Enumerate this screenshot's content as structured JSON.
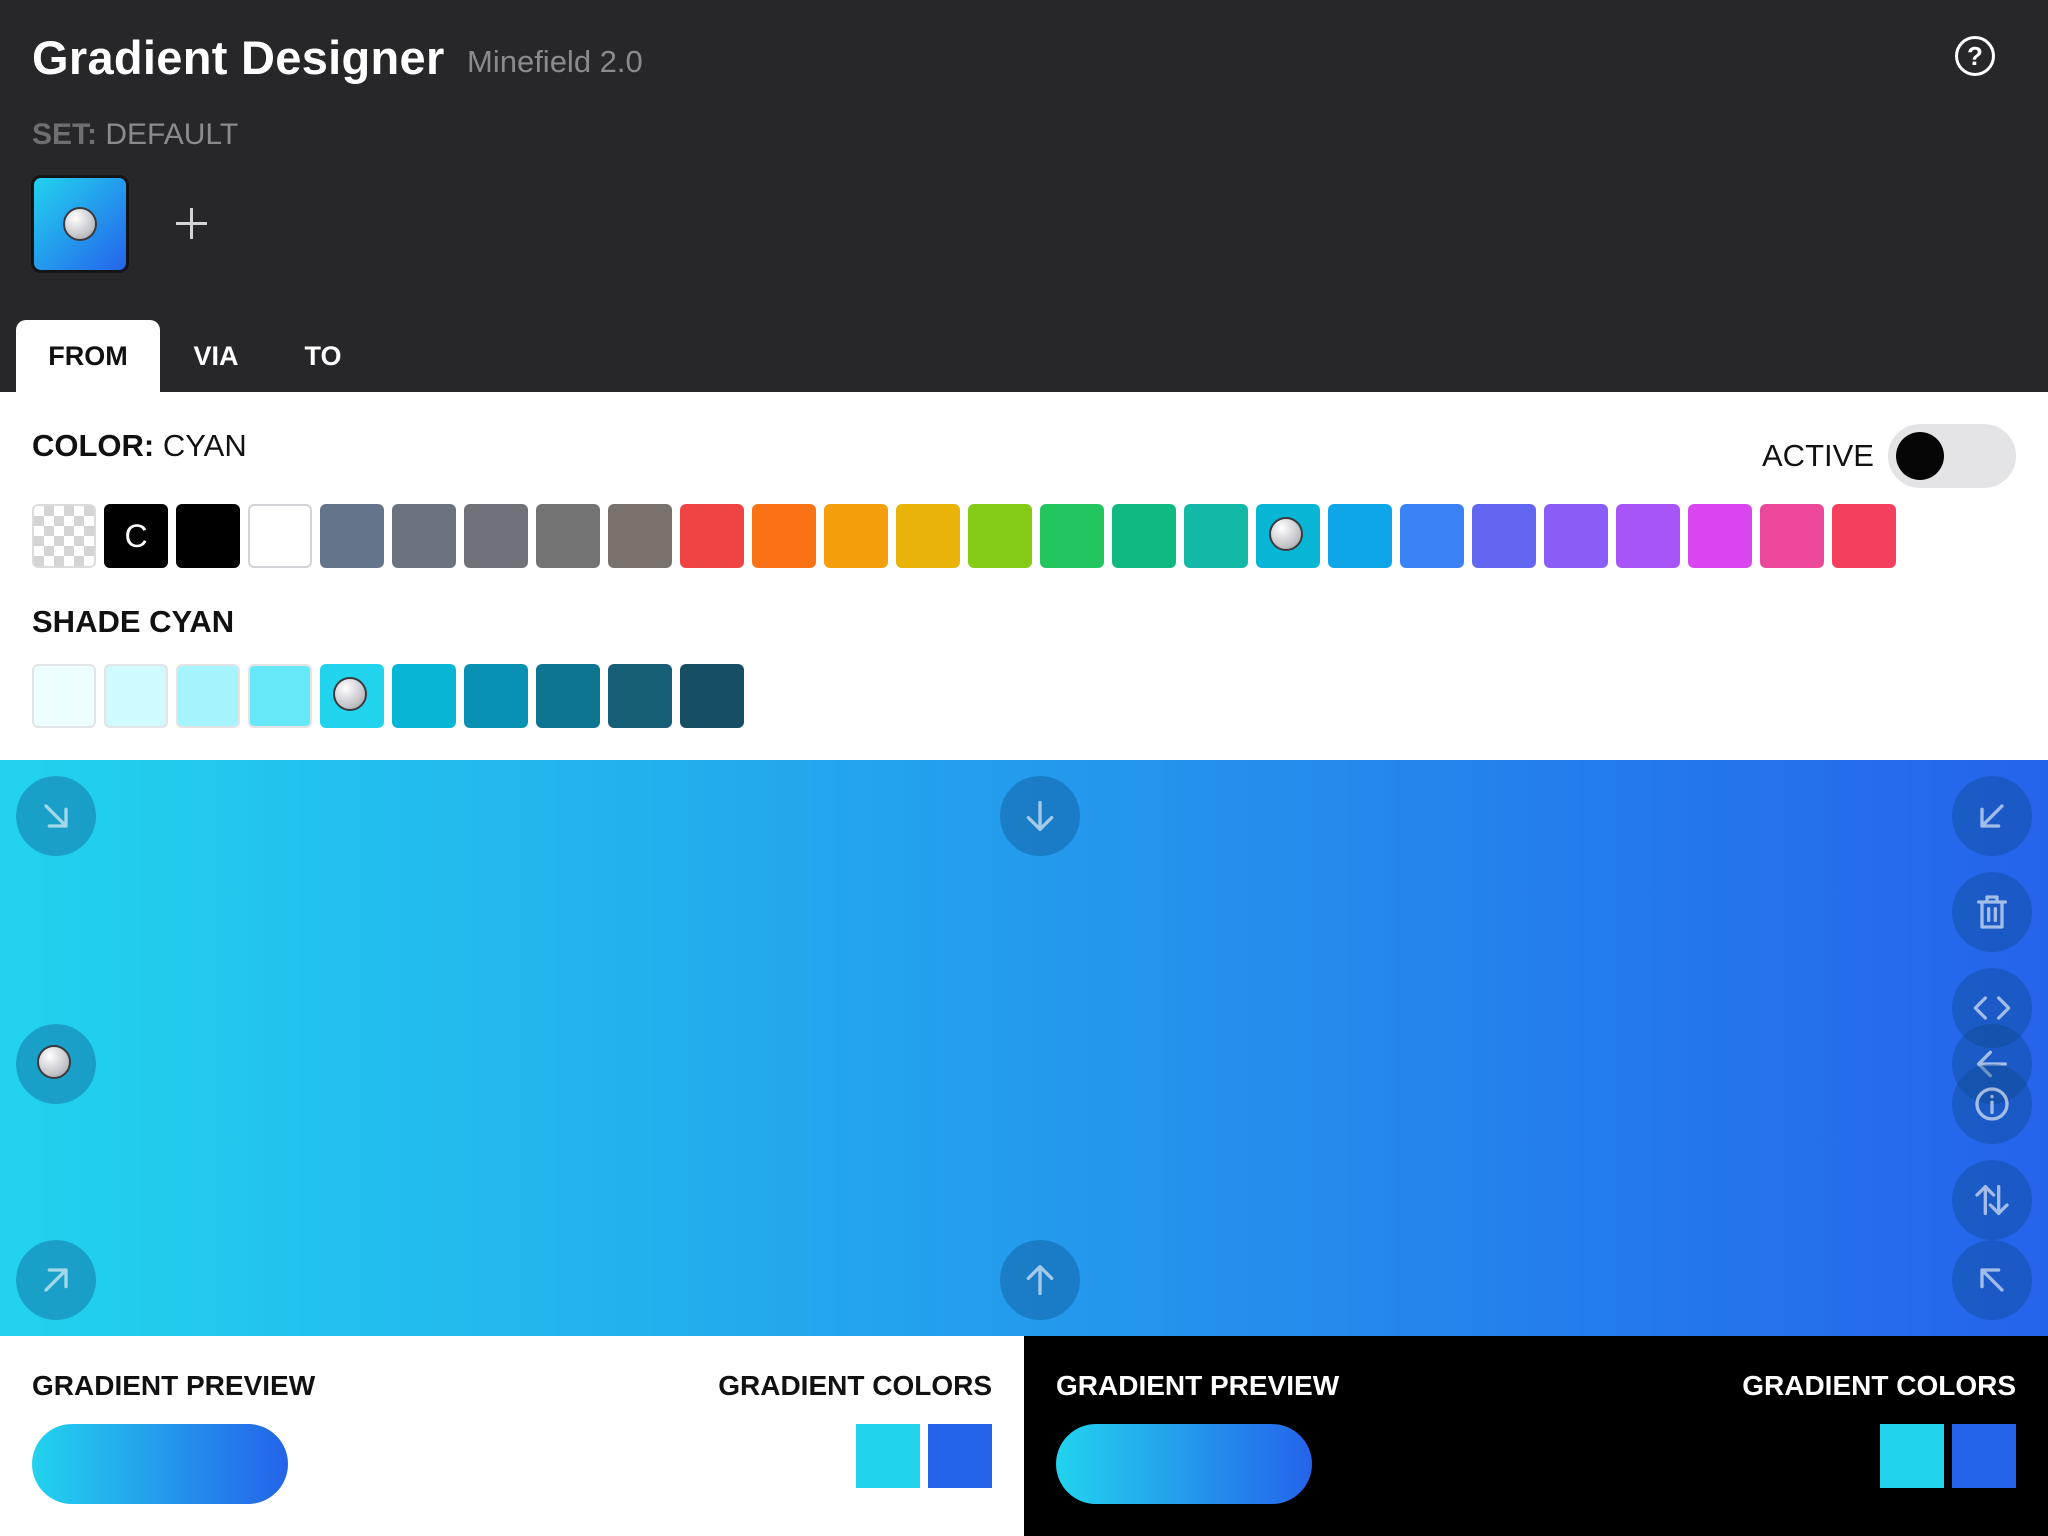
{
  "header": {
    "title": "Gradient Designer",
    "subtitle": "Minefield 2.0",
    "set_label": "SET:",
    "set_value": "DEFAULT",
    "help_glyph": "?",
    "help_icon": "question-circle-icon",
    "add_icon": "plus-icon"
  },
  "tabs": [
    {
      "label": "FROM",
      "active": true
    },
    {
      "label": "VIA",
      "active": false
    },
    {
      "label": "TO",
      "active": false
    }
  ],
  "color_panel": {
    "label": "COLOR:",
    "value": "CYAN",
    "active_label": "ACTIVE",
    "active_on": false,
    "current_swatch_letter": "C",
    "swatches": [
      {
        "name": "transparent",
        "hex": "transparent"
      },
      {
        "name": "current",
        "hex": "#000000"
      },
      {
        "name": "black",
        "hex": "#000000"
      },
      {
        "name": "white",
        "hex": "#ffffff"
      },
      {
        "name": "slate",
        "hex": "#64748b"
      },
      {
        "name": "gray",
        "hex": "#6b7280"
      },
      {
        "name": "zinc",
        "hex": "#71717a"
      },
      {
        "name": "neutral",
        "hex": "#737373"
      },
      {
        "name": "stone",
        "hex": "#78716c"
      },
      {
        "name": "red",
        "hex": "#ef4444"
      },
      {
        "name": "orange",
        "hex": "#f97316"
      },
      {
        "name": "amber",
        "hex": "#f59e0b"
      },
      {
        "name": "yellow",
        "hex": "#eab308"
      },
      {
        "name": "lime",
        "hex": "#84cc16"
      },
      {
        "name": "green",
        "hex": "#22c55e"
      },
      {
        "name": "emerald",
        "hex": "#10b981"
      },
      {
        "name": "teal",
        "hex": "#14b8a6"
      },
      {
        "name": "cyan",
        "hex": "#06b6d4",
        "selected": true
      },
      {
        "name": "sky",
        "hex": "#0ea5e9"
      },
      {
        "name": "blue",
        "hex": "#3b82f6"
      },
      {
        "name": "indigo",
        "hex": "#6366f1"
      },
      {
        "name": "violet",
        "hex": "#8b5cf6"
      },
      {
        "name": "purple",
        "hex": "#a855f7"
      },
      {
        "name": "fuchsia",
        "hex": "#d946ef"
      },
      {
        "name": "pink",
        "hex": "#ec4899"
      },
      {
        "name": "rose",
        "hex": "#f43f5e"
      }
    ]
  },
  "shade_panel": {
    "label": "SHADE CYAN",
    "shades": [
      {
        "hex": "#ecfeff"
      },
      {
        "hex": "#cffafe"
      },
      {
        "hex": "#a5f3fc"
      },
      {
        "hex": "#67e8f9"
      },
      {
        "hex": "#22d3ee",
        "selected": true
      },
      {
        "hex": "#06b6d4"
      },
      {
        "hex": "#0891b2"
      },
      {
        "hex": "#0e7490"
      },
      {
        "hex": "#155e75"
      },
      {
        "hex": "#164e63"
      }
    ]
  },
  "gradient": {
    "from_color": "#22d3ee",
    "to_color": "#2563eb",
    "direction": "to right",
    "controls": [
      {
        "name": "direction-bottom-right",
        "icon": "arrow-down-right-icon"
      },
      {
        "name": "direction-bottom",
        "icon": "arrow-down-icon"
      },
      {
        "name": "direction-bottom-left",
        "icon": "arrow-down-left-icon"
      },
      {
        "name": "delete",
        "icon": "trash-icon"
      },
      {
        "name": "code",
        "icon": "code-icon"
      },
      {
        "name": "direction-left",
        "icon": "arrow-left-icon"
      },
      {
        "name": "info",
        "icon": "info-icon"
      },
      {
        "name": "direction-right-selected",
        "icon": "knob-icon"
      },
      {
        "name": "swap",
        "icon": "swap-vertical-icon"
      },
      {
        "name": "direction-top-right",
        "icon": "arrow-up-right-icon"
      },
      {
        "name": "direction-top",
        "icon": "arrow-up-icon"
      },
      {
        "name": "direction-top-left",
        "icon": "arrow-up-left-icon"
      }
    ]
  },
  "preview_light": {
    "preview_label": "GRADIENT PREVIEW",
    "colors_label": "GRADIENT COLORS",
    "colors": [
      "#22d3ee",
      "#2563eb"
    ]
  },
  "preview_dark": {
    "preview_label": "GRADIENT PREVIEW",
    "colors_label": "GRADIENT COLORS",
    "colors": [
      "#22d3ee",
      "#2563eb"
    ]
  }
}
